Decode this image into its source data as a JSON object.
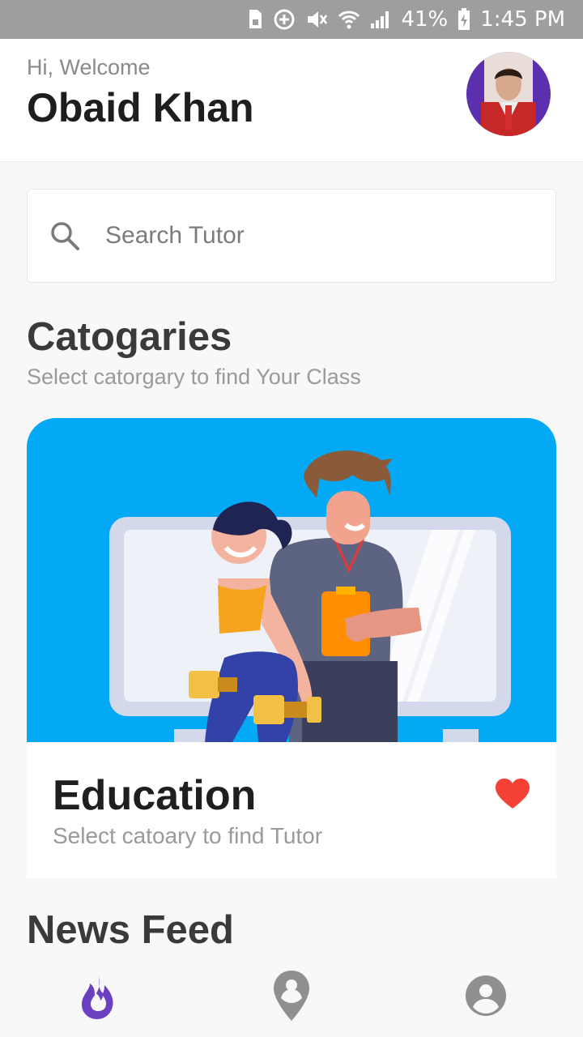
{
  "status_bar": {
    "battery_percent": "41%",
    "time": "1:45 PM",
    "icons": [
      "sim-icon",
      "data-saver-icon",
      "mute-icon",
      "wifi-icon",
      "signal-icon",
      "battery-charging-icon"
    ]
  },
  "header": {
    "greeting": "Hi, Welcome",
    "user_name": "Obaid Khan",
    "avatar_icon": "user-avatar-photo"
  },
  "search": {
    "placeholder": "Search Tutor",
    "icon": "search-icon"
  },
  "categories": {
    "title": "Catogaries",
    "subtitle": "Select catorgary to find Your Class",
    "cards": [
      {
        "title": "Education",
        "subtitle": "Select catoary to find Tutor",
        "favorite": true,
        "icon": "heart-icon",
        "image": "fitness-trainers-illustration"
      }
    ]
  },
  "news_feed": {
    "title": "News Feed"
  },
  "bottom_nav": {
    "items": [
      {
        "icon": "flame-icon",
        "active": true
      },
      {
        "icon": "location-pin-icon",
        "active": false
      },
      {
        "icon": "profile-icon",
        "active": false
      }
    ]
  },
  "colors": {
    "accent": "#6a3fc0",
    "heart": "#f44336",
    "card_bg": "#03a9f4",
    "status_bar": "#9e9e9e",
    "nav_inactive": "#8f8f8f"
  }
}
